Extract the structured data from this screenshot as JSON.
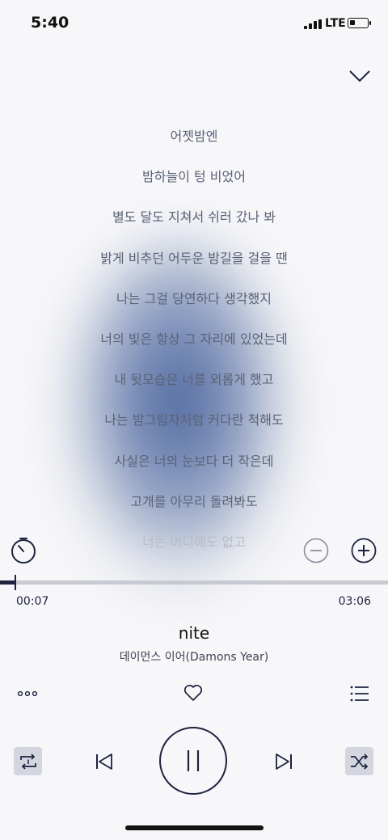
{
  "status_bar": {
    "time": "5:40",
    "network": "LTE"
  },
  "lyrics": [
    "어젯밤엔",
    "밤하늘이 텅 비었어",
    "별도 달도 지쳐서 쉬러 갔나 봐",
    "밝게 비추던 어두운 밤길을 걸을 땐",
    "나는 그걸 당연하다 생각했지",
    "너의 빛은 항상 그 자리에 있었는데",
    "내 뒷모습은 너를 외롭게 했고",
    "나는 밤그림자처럼 커다란 척해도",
    "사실은 너의 눈보다 더 작은데",
    "고개를 아무리 돌려봐도",
    "너는 어디에도 없고"
  ],
  "player": {
    "elapsed": "00:07",
    "total": "03:06",
    "progress_fraction": 0.038,
    "title": "nite",
    "artist": "데이먼스 이어(Damons Year)"
  },
  "colors": {
    "accent": "#1d2340",
    "track": "#c7cad3",
    "lyric_text": "#5b6276",
    "background": "#f7f7f9"
  },
  "icons": {
    "collapse": "chevron-down-icon",
    "timer": "timer-icon",
    "font_smaller": "minus-circle-icon",
    "font_larger": "plus-circle-icon",
    "more": "more-dots-icon",
    "like": "heart-icon",
    "playlist": "playlist-icon",
    "repeat": "repeat-one-icon",
    "previous": "previous-icon",
    "pause": "pause-icon",
    "next": "next-icon",
    "shuffle": "shuffle-icon"
  }
}
